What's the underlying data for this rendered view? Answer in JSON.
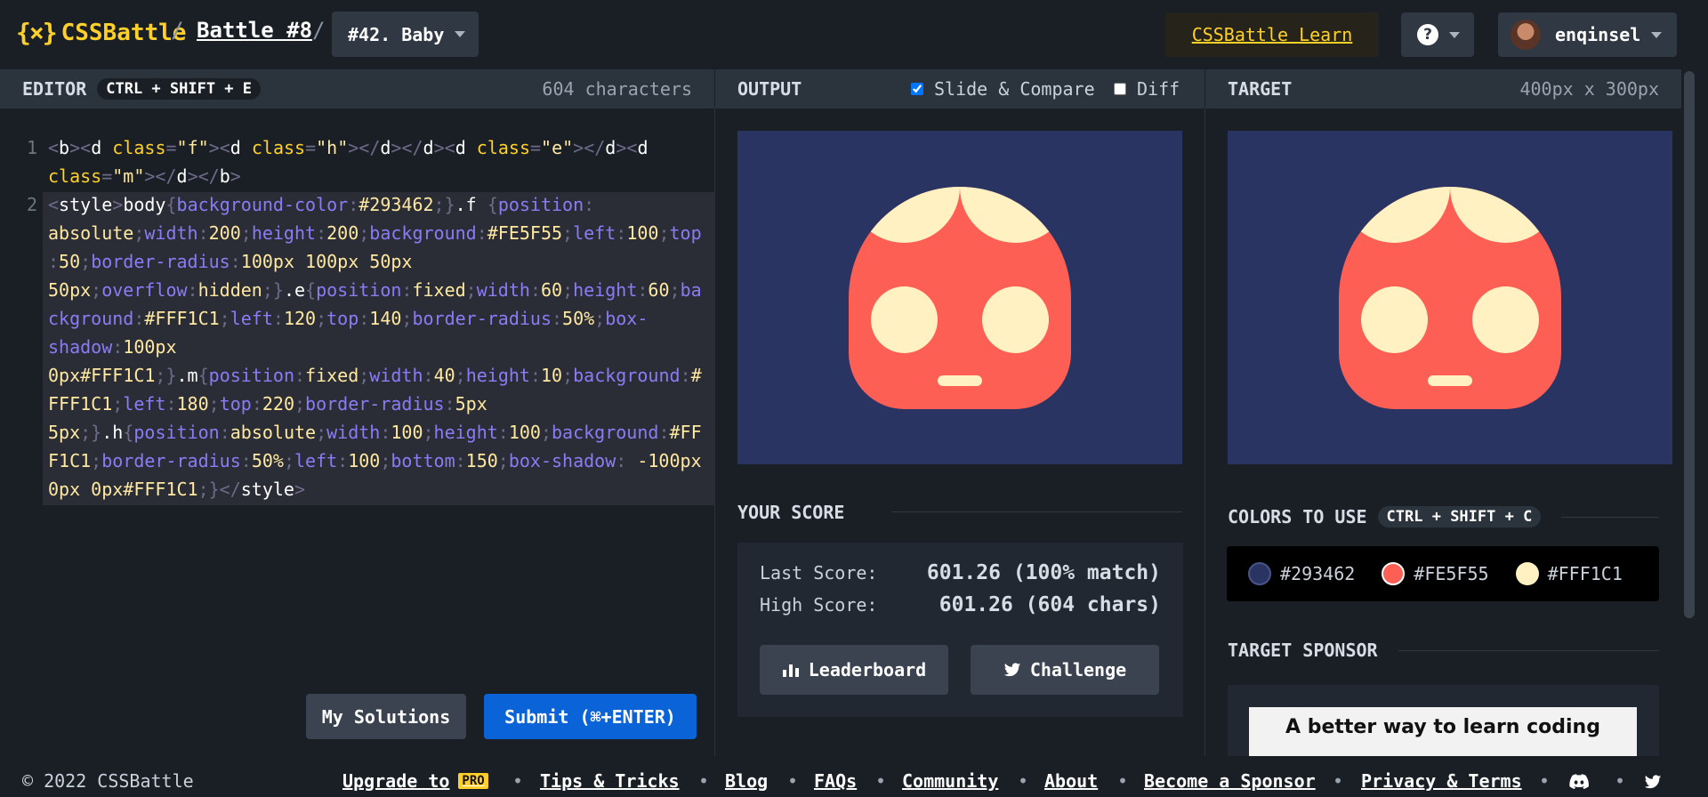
{
  "header": {
    "logo_mark": "{×}",
    "logo_text": "CSSBattle",
    "breadcrumb_battle": "Battle #8",
    "target_selector": "#42. Baby",
    "learn_link": "CSSBattle Learn",
    "help_icon": "question-circle-icon",
    "username": "enqinsel"
  },
  "editor": {
    "title": "EDITOR",
    "shortcut": "CTRL + SHIFT + E",
    "char_count": "604 characters",
    "code_lines": [
      {
        "num": "1",
        "text": "<b><d class=\"f\"><d class=\"h\"></d></d><d class=\"e\"></d><d"
      },
      {
        "num": "",
        "text": "class=\"m\"></d></b>"
      },
      {
        "num": "2",
        "text": "<style>body{background-color:#293462;}.f {position:"
      },
      {
        "num": "",
        "text": "absolute;width:200;height:200;background:#FE5F55;left:100;top"
      },
      {
        "num": "",
        "text": ":50;border-radius:100px 100px 50px"
      },
      {
        "num": "",
        "text": "50px;overflow:hidden;}.e{position:fixed;width:60;height:60;ba"
      },
      {
        "num": "",
        "text": "ckground:#FFF1C1;left:120;top:140;border-radius:50%;box-"
      },
      {
        "num": "",
        "text": "shadow:100px"
      },
      {
        "num": "",
        "text": "0px#FFF1C1;}.m{position:fixed;width:40;height:10;background:#"
      },
      {
        "num": "",
        "text": "FFF1C1;left:180;top:220;border-radius:5px"
      },
      {
        "num": "",
        "text": "5px;}.h{position:absolute;width:100;height:100;background:#FF"
      },
      {
        "num": "",
        "text": "F1C1;border-radius:50%;left:100;bottom:150;box-shadow: -100px"
      },
      {
        "num": "",
        "text": "0px 0px#FFF1C1;}</style>"
      }
    ],
    "my_solutions": "My Solutions",
    "submit": "Submit (⌘+ENTER)"
  },
  "output": {
    "title": "OUTPUT",
    "slide_compare": "Slide & Compare",
    "slide_compare_checked": true,
    "diff": "Diff",
    "diff_checked": false
  },
  "score": {
    "title": "YOUR SCORE",
    "last_label": "Last Score:",
    "last_value": "601.26 (100% match)",
    "high_label": "High Score:",
    "high_value": "601.26 (604 chars)",
    "leaderboard": "Leaderboard",
    "challenge": "Challenge"
  },
  "target": {
    "title": "TARGET",
    "size": "400px x 300px",
    "colors_title": "COLORS TO USE",
    "colors_shortcut": "CTRL + SHIFT + C",
    "colors": [
      "#293462",
      "#FE5F55",
      "#FFF1C1"
    ],
    "sponsor_title": "TARGET SPONSOR",
    "sponsor_text": "A better way to learn coding"
  },
  "footer": {
    "copyright": "© 2022 CSSBattle",
    "upgrade": "Upgrade to",
    "pro_badge": "PRO",
    "links": [
      "Tips & Tricks",
      "Blog",
      "FAQs",
      "Community",
      "About",
      "Become a Sponsor",
      "Privacy & Terms"
    ],
    "separator": "•"
  }
}
